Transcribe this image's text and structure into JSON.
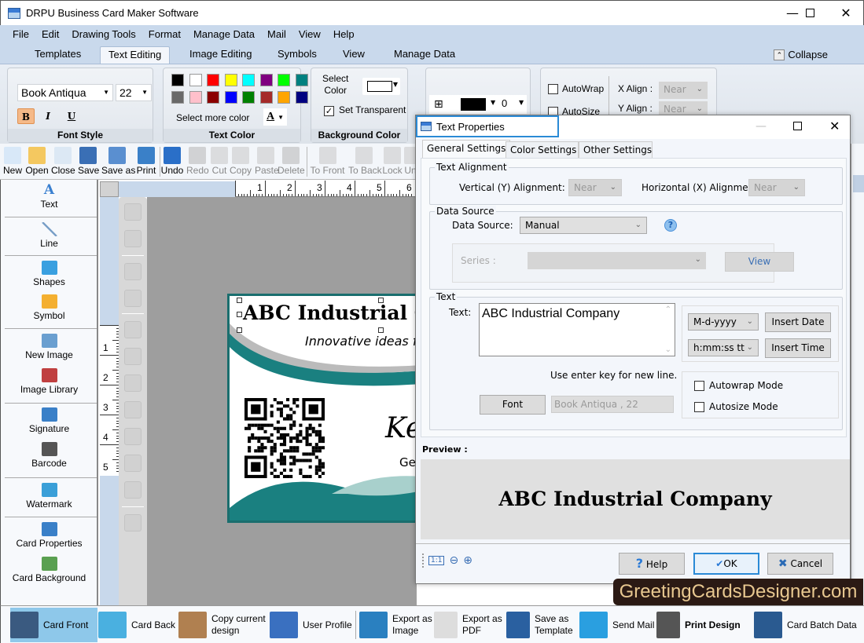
{
  "window": {
    "title": "DRPU Business Card Maker Software",
    "controls": [
      "minimize",
      "maximize",
      "close"
    ]
  },
  "menu": [
    "File",
    "Edit",
    "Drawing Tools",
    "Format",
    "Manage Data",
    "Mail",
    "View",
    "Help"
  ],
  "ribbon_tabs": {
    "items": [
      "Templates",
      "Text Editing",
      "Image Editing",
      "Symbols",
      "View",
      "Manage Data"
    ],
    "active": "Text Editing",
    "collapse_label": "Collapse"
  },
  "ribbon": {
    "font_style": {
      "label": "Font Style",
      "font_name": "Book Antiqua",
      "font_size": "22",
      "bold": "B",
      "italic": "I",
      "underline": "U"
    },
    "text_color": {
      "label": "Text Color",
      "swatches": [
        "#000000",
        "#ffffff",
        "#ff0000",
        "#ffff00",
        "#00ffff",
        "#800080",
        "#00ff00",
        "#008080",
        "#696969",
        "#ffc0cb",
        "#8b0000",
        "#0000ff",
        "#008000",
        "#a52a2a",
        "#ffa500",
        "#000080"
      ],
      "more_label": "Select more color",
      "font_color_glyph": "A"
    },
    "background_color": {
      "label": "Background Color",
      "select_label_1": "Select",
      "select_label_2": "Color",
      "transparent_label": "Set Transparent",
      "transparent_checked": true
    },
    "border": {
      "width_value": "0"
    },
    "alignment": {
      "autowrap_label": "AutoWrap",
      "autosize_label": "AutoSize",
      "x_align_label": "X Align :",
      "x_align_value": "Near",
      "y_align_label": "Y Align :",
      "y_align_value": "Near"
    }
  },
  "toolbar": [
    {
      "label": "New",
      "icon": "new-file-icon",
      "enabled": true
    },
    {
      "label": "Open",
      "icon": "open-folder-icon",
      "enabled": true
    },
    {
      "label": "Close",
      "icon": "close-file-icon",
      "enabled": true
    },
    {
      "label": "Save",
      "icon": "save-icon",
      "enabled": true
    },
    {
      "label": "Save as",
      "icon": "save-as-icon",
      "enabled": true
    },
    {
      "label": "Print",
      "icon": "print-icon",
      "enabled": true
    },
    {
      "label": "Undo",
      "icon": "undo-icon",
      "enabled": true
    },
    {
      "label": "Redo",
      "icon": "redo-icon",
      "enabled": false
    },
    {
      "label": "Cut",
      "icon": "cut-icon",
      "enabled": false
    },
    {
      "label": "Copy",
      "icon": "copy-icon",
      "enabled": false
    },
    {
      "label": "Paste",
      "icon": "paste-icon",
      "enabled": false
    },
    {
      "label": "Delete",
      "icon": "delete-icon",
      "enabled": false
    },
    {
      "label": "To Front",
      "icon": "to-front-icon",
      "enabled": false
    },
    {
      "label": "To Back",
      "icon": "to-back-icon",
      "enabled": false
    },
    {
      "label": "Lock",
      "icon": "lock-icon",
      "enabled": false
    },
    {
      "label": "Un",
      "icon": "unlock-icon",
      "enabled": false
    }
  ],
  "left_panel": [
    {
      "label": "Text",
      "icon": "text-tool-icon"
    },
    {
      "label": "Line",
      "icon": "line-tool-icon"
    },
    {
      "label": "Shapes",
      "icon": "shapes-tool-icon"
    },
    {
      "label": "Symbol",
      "icon": "symbol-tool-icon"
    },
    {
      "label": "New Image",
      "icon": "new-image-icon"
    },
    {
      "label": "Image Library",
      "icon": "image-library-icon"
    },
    {
      "label": "Signature",
      "icon": "signature-icon"
    },
    {
      "label": "Barcode",
      "icon": "barcode-icon"
    },
    {
      "label": "Watermark",
      "icon": "watermark-icon"
    },
    {
      "label": "Card Properties",
      "icon": "card-properties-icon"
    },
    {
      "label": "Card Background",
      "icon": "card-background-icon"
    }
  ],
  "rulers": {
    "horizontal": [
      "1",
      "2",
      "3",
      "4",
      "5",
      "6"
    ],
    "vertical": [
      "1",
      "2",
      "3",
      "4",
      "5"
    ]
  },
  "card": {
    "company": "ABC Industrial C",
    "tagline": "Innovative ideas f",
    "name_partial": "Ken",
    "title_partial": "Ge",
    "accent": "#1a8080"
  },
  "dialog": {
    "title": "Text Properties",
    "tabs": [
      "General Settings",
      "Color Settings",
      "Other Settings"
    ],
    "active_tab": "General Settings",
    "text_alignment": {
      "legend": "Text Alignment",
      "vertical_label": "Vertical (Y) Alignment:",
      "vertical_value": "Near",
      "horizontal_label": "Horizontal (X) Alignment:",
      "horizontal_value": "Near"
    },
    "data_source": {
      "legend": "Data Source",
      "label": "Data Source:",
      "value": "Manual",
      "series_label": "Series :",
      "series_value": "",
      "view_label": "View"
    },
    "text": {
      "legend": "Text",
      "label": "Text:",
      "value": "ABC Industrial Company",
      "date_format": "M-d-yyyy",
      "insert_date_label": "Insert Date",
      "time_format": "h:mm:ss tt",
      "insert_time_label": "Insert Time",
      "hint": "Use enter key for new line.",
      "font_button": "Font",
      "font_value": "Book Antiqua , 22",
      "autowrap_label": "Autowrap Mode",
      "autowrap_checked": false,
      "autosize_label": "Autosize Mode",
      "autosize_checked": false
    },
    "preview": {
      "label": "Preview :",
      "text": "ABC Industrial Company"
    },
    "zoom_actual": "1:1",
    "help_label": "Help",
    "ok_label": "OK",
    "cancel_label": "Cancel"
  },
  "bottom_bar": [
    {
      "label": "Card Front",
      "icon": "card-front-icon",
      "active": true
    },
    {
      "label": "Card Back",
      "icon": "card-back-icon",
      "active": false
    },
    {
      "label": "Copy current design",
      "icon": "copy-design-icon",
      "active": false
    },
    {
      "label": "User Profile",
      "icon": "user-profile-icon",
      "active": false
    },
    {
      "label": "Export as Image",
      "icon": "export-image-icon",
      "active": false
    },
    {
      "label": "Export as PDF",
      "icon": "export-pdf-icon",
      "active": false
    },
    {
      "label": "Save as Template",
      "icon": "save-template-icon",
      "active": false
    },
    {
      "label": "Send Mail",
      "icon": "send-mail-icon",
      "active": false
    },
    {
      "label": "Print Design",
      "icon": "print-design-icon",
      "active": false
    },
    {
      "label": "Card Batch Data",
      "icon": "card-batch-data-icon",
      "active": false
    }
  ],
  "watermark_text": "GreetingCardsDesigner.com"
}
